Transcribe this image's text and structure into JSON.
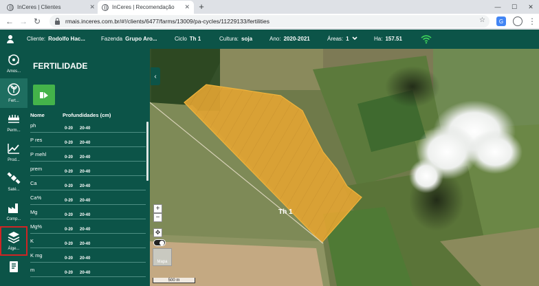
{
  "browser": {
    "tabs": [
      {
        "label": "InCeres | Clientes",
        "active": false
      },
      {
        "label": "InCeres | Recomendação",
        "active": true
      }
    ],
    "new_tab": "+",
    "window_controls": {
      "minimize": "—",
      "maximize": "☐",
      "close": "✕"
    },
    "url": "rmais.inceres.com.br/#!/clients/6477/farms/13009/pa-cycles/11229133/fertilities",
    "tab_close": "✕",
    "nav": {
      "back": "←",
      "forward": "→",
      "reload": "↻",
      "star": "☆",
      "menu": "⋮"
    },
    "extension_label": "G"
  },
  "appbar": {
    "cliente_label": "Cliente:",
    "cliente_value": "Rodolfo Hac...",
    "fazenda_label": "Fazenda",
    "fazenda_value": "Grupo Aro...",
    "ciclo_label": "Ciclo",
    "ciclo_value": "Th 1",
    "cultura_label": "Cultura:",
    "cultura_value": "soja",
    "ano_label": "Ano:",
    "ano_value": "2020-2021",
    "areas_label": "Áreas:",
    "areas_value": "1",
    "ha_label": "Ha:",
    "ha_value": "157.51"
  },
  "rail": [
    {
      "label": "Amos...",
      "icon": "sampling-icon"
    },
    {
      "label": "Fert...",
      "icon": "fertility-icon"
    },
    {
      "label": "Perm...",
      "icon": "permission-icon"
    },
    {
      "label": "Prod...",
      "icon": "production-chart-icon"
    },
    {
      "label": "Saté...",
      "icon": "satellite-icon"
    },
    {
      "label": "Comp...",
      "icon": "factory-icon"
    },
    {
      "label": "Álge...",
      "icon": "layers-icon"
    },
    {
      "label": "",
      "icon": "report-icon"
    }
  ],
  "panel": {
    "title": "FERTILIDADE",
    "col_name": "Nome",
    "col_depth": "Profundidades (cm)",
    "rows": [
      {
        "name": "ph",
        "d1": "0-20",
        "d2": "20-40"
      },
      {
        "name": "P res",
        "d1": "0-20",
        "d2": "20-40"
      },
      {
        "name": "P mehl",
        "d1": "0-20",
        "d2": "20-40"
      },
      {
        "name": "prem",
        "d1": "0-20",
        "d2": "20-40"
      },
      {
        "name": "Ca",
        "d1": "0-20",
        "d2": "20-40"
      },
      {
        "name": "Ca%",
        "d1": "0-20",
        "d2": "20-40"
      },
      {
        "name": "Mg",
        "d1": "0-20",
        "d2": "20-40"
      },
      {
        "name": "Mg%",
        "d1": "0-20",
        "d2": "20-40"
      },
      {
        "name": "K",
        "d1": "0-20",
        "d2": "20-40"
      },
      {
        "name": "K mg",
        "d1": "0-20",
        "d2": "20-40"
      },
      {
        "name": "m",
        "d1": "0-20",
        "d2": "20-40"
      }
    ]
  },
  "map": {
    "field_label": "Th 1",
    "zoom_in": "+",
    "zoom_out": "−",
    "pan": "✥",
    "collapse": "‹",
    "mapa_label": "Mapa",
    "scale_label": "500 m"
  },
  "colors": {
    "brand": "#0c5448",
    "accent_green": "#44b34a",
    "field_fill": "#e8a632",
    "selected_outline": "#d02424"
  }
}
